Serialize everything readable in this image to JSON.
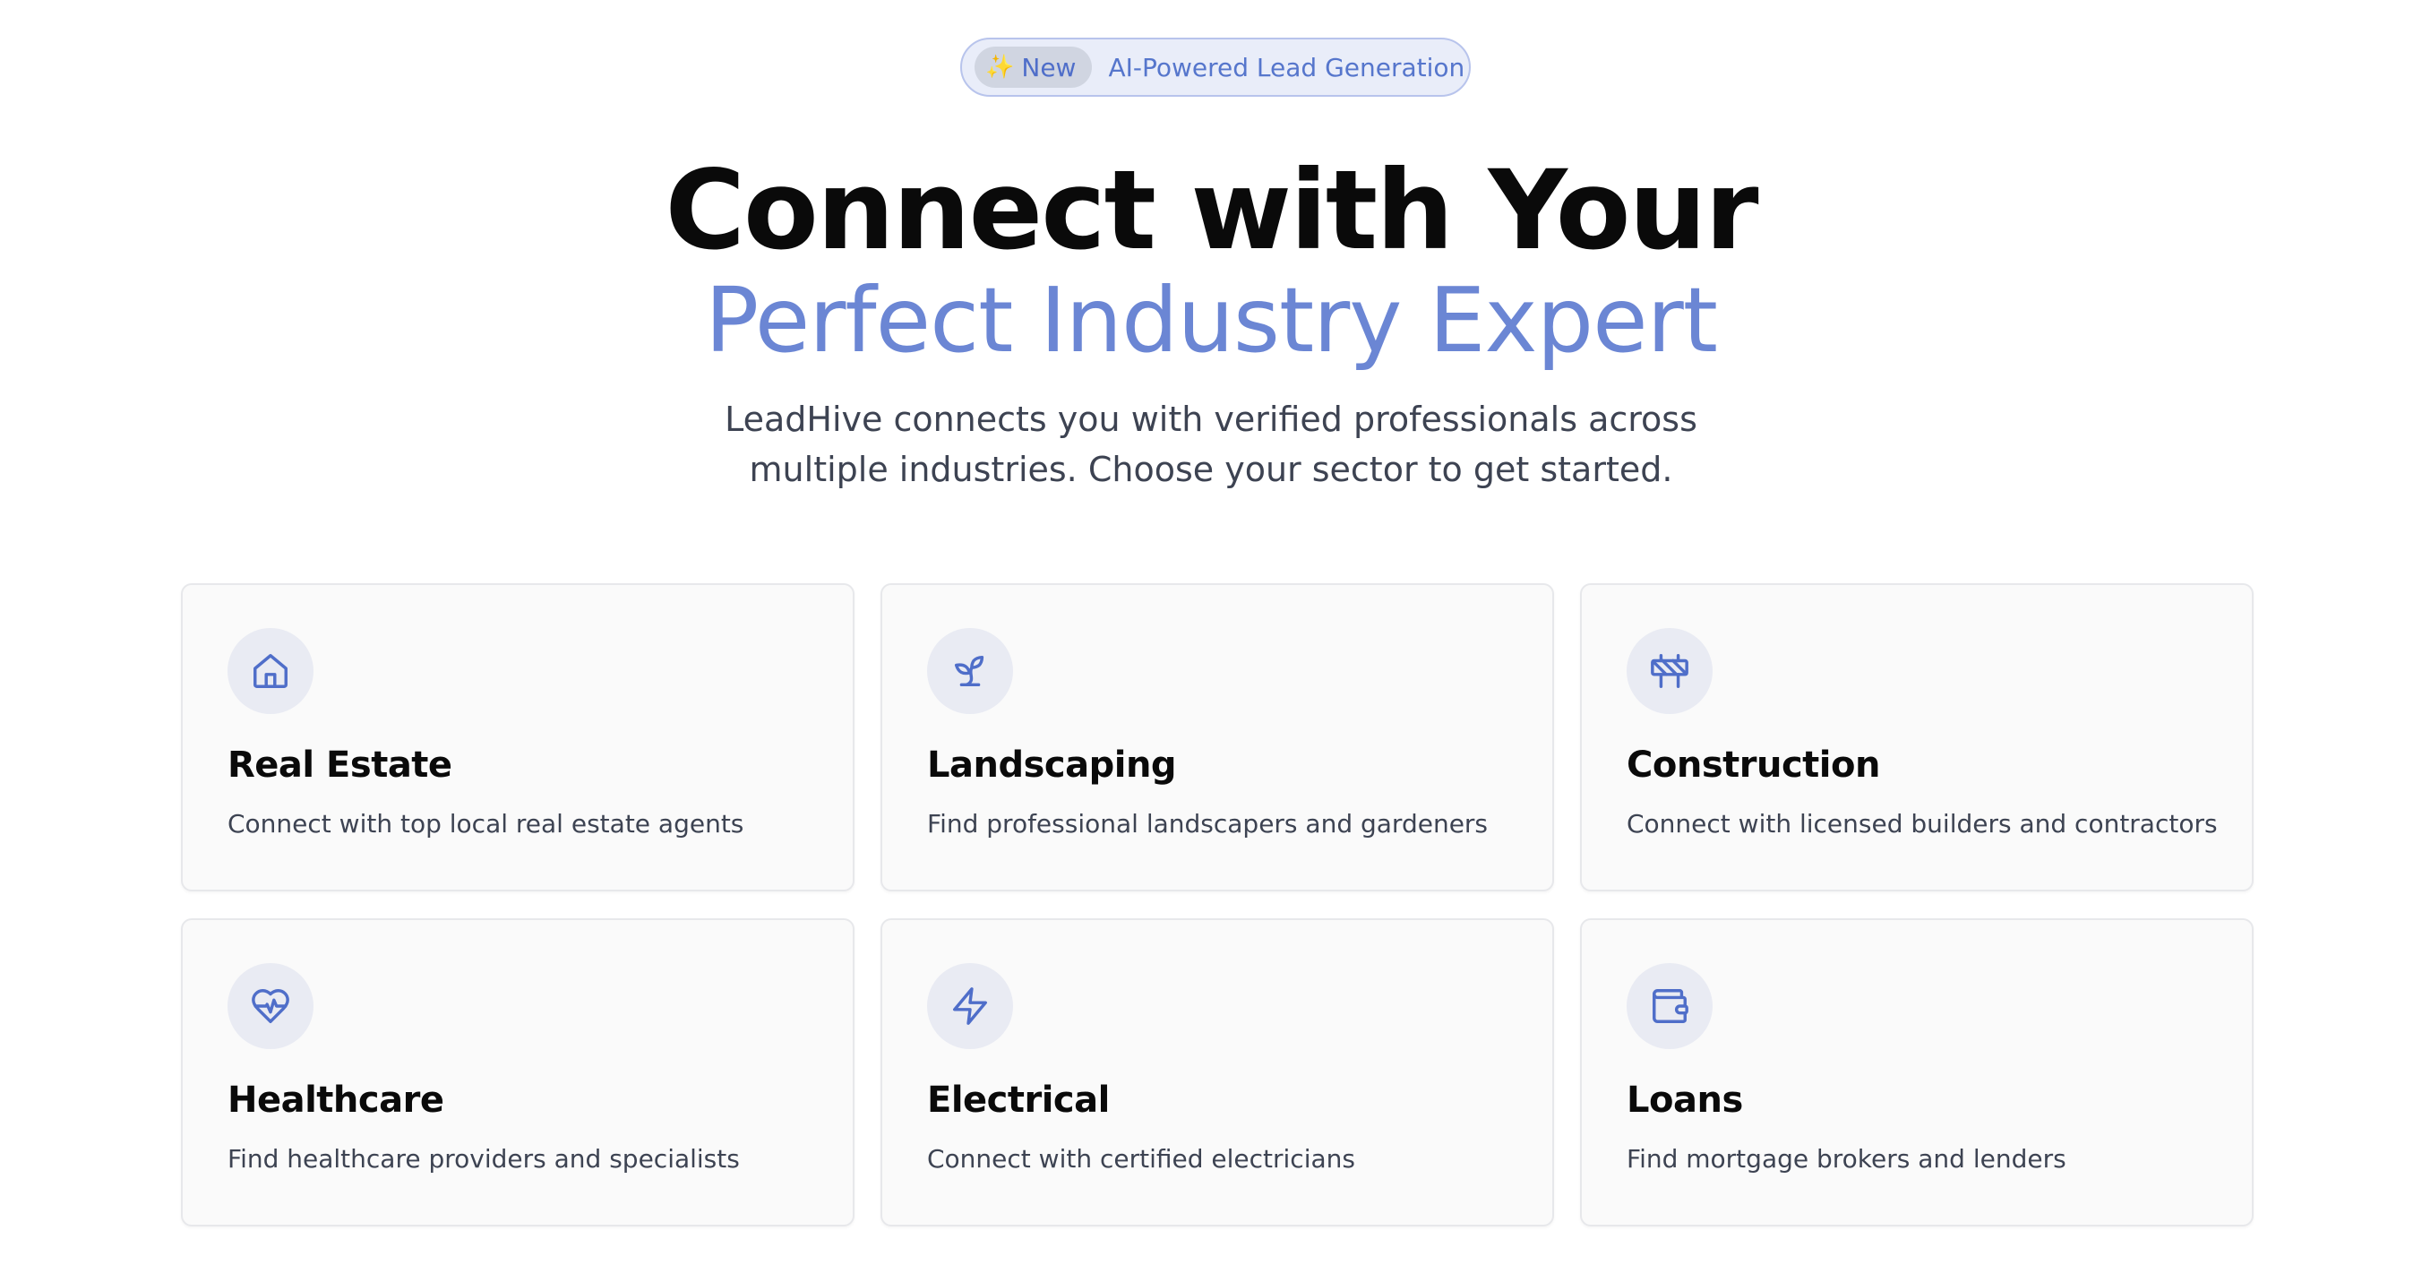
{
  "badge": {
    "new_label": "New",
    "text": "AI-Powered Lead Generation"
  },
  "hero": {
    "title_line1": "Connect with Your",
    "title_line2": "Perfect Industry Expert",
    "subtitle_line1": "LeadHive connects you with verified professionals across",
    "subtitle_line2": "multiple industries. Choose your sector to get started."
  },
  "industries": [
    {
      "title": "Real Estate",
      "description": "Connect with top local real estate agents",
      "icon": "home-icon"
    },
    {
      "title": "Landscaping",
      "description": "Find professional landscapers and gardeners",
      "icon": "sprout-icon"
    },
    {
      "title": "Construction",
      "description": "Connect with licensed builders and contractors",
      "icon": "construction-barrier-icon"
    },
    {
      "title": "Healthcare",
      "description": "Find healthcare providers and specialists",
      "icon": "heart-pulse-icon"
    },
    {
      "title": "Electrical",
      "description": "Connect with certified electricians",
      "icon": "lightning-icon"
    },
    {
      "title": "Loans",
      "description": "Find mortgage brokers and lenders",
      "icon": "wallet-icon"
    }
  ],
  "colors": {
    "accent": "#4f6ec9",
    "title_gradient": "#6b86d4",
    "badge_bg": "#e9edf9",
    "icon_bg": "#e9ebf3"
  }
}
